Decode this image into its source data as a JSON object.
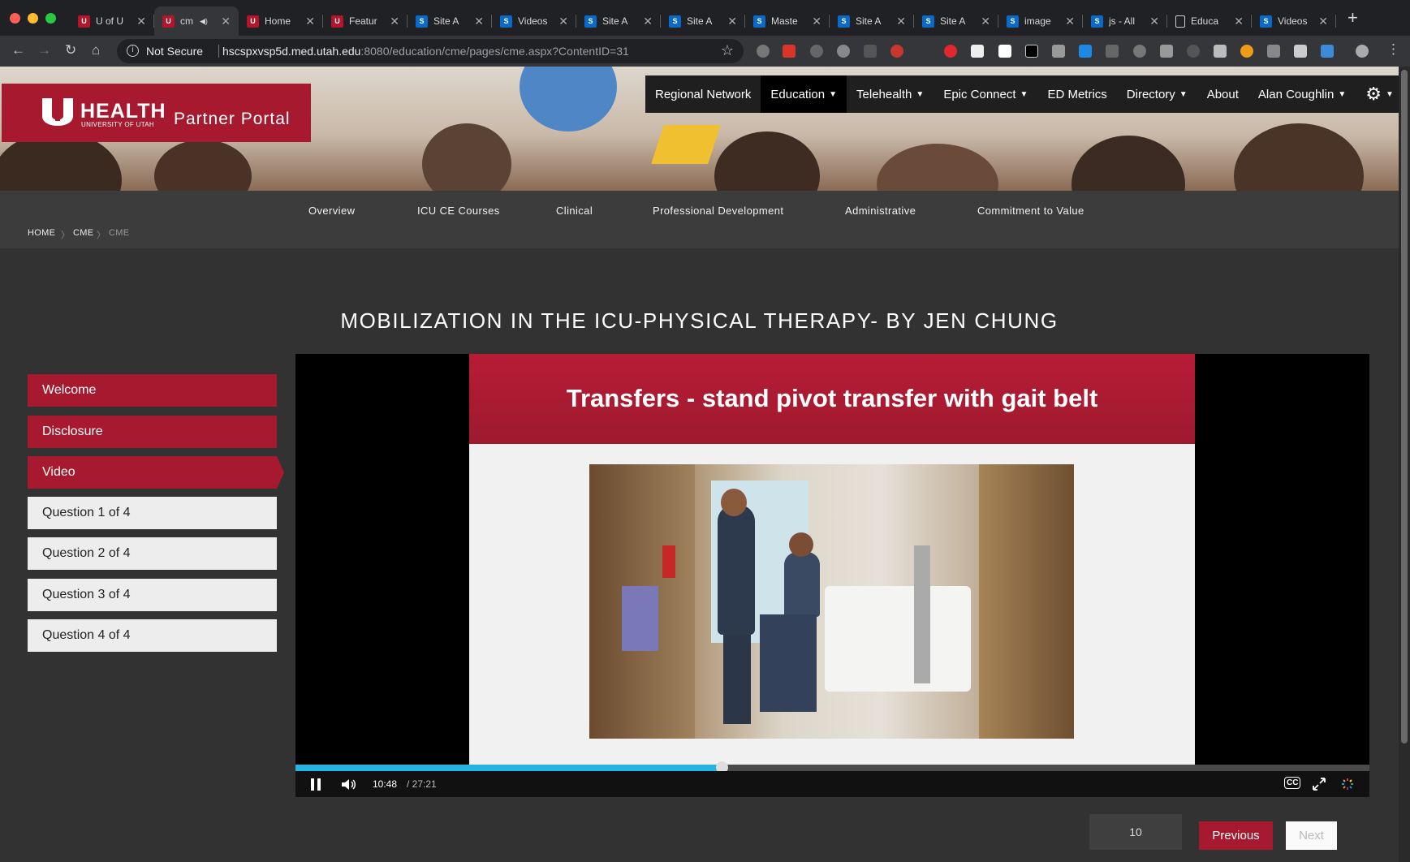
{
  "browser": {
    "tabs": [
      {
        "title": "U of U",
        "favicon": "utah-u-icon"
      },
      {
        "title": "cm",
        "favicon": "utah-u-icon",
        "active": true,
        "audio": true
      },
      {
        "title": "Home",
        "favicon": "utah-u-icon"
      },
      {
        "title": "Featur",
        "favicon": "utah-u-icon"
      },
      {
        "title": "Site A",
        "favicon": "sharepoint-icon"
      },
      {
        "title": "Videos",
        "favicon": "sharepoint-icon"
      },
      {
        "title": "Site A",
        "favicon": "sharepoint-icon"
      },
      {
        "title": "Site A",
        "favicon": "sharepoint-icon"
      },
      {
        "title": "Maste",
        "favicon": "sharepoint-icon"
      },
      {
        "title": "Site A",
        "favicon": "sharepoint-icon"
      },
      {
        "title": "Site A",
        "favicon": "sharepoint-icon"
      },
      {
        "title": "image",
        "favicon": "sharepoint-icon"
      },
      {
        "title": "js - All",
        "favicon": "sharepoint-icon"
      },
      {
        "title": "Educa",
        "favicon": "document-icon"
      },
      {
        "title": "Videos",
        "favicon": "sharepoint-icon"
      }
    ],
    "security_label": "Not Secure",
    "url_host": "hscspxvsp5d.med.utah.edu",
    "url_rest": ":8080/education/cme/pages/cme.aspx?ContentID=31"
  },
  "site": {
    "logo_health": "HEALTH",
    "logo_university": "UNIVERSITY OF UTAH",
    "logo_portal": "Partner Portal",
    "brand_color": "#a6192e",
    "top_nav": [
      {
        "label": "Regional Network",
        "dropdown": false
      },
      {
        "label": "Education",
        "dropdown": true,
        "active": true
      },
      {
        "label": "Telehealth",
        "dropdown": true
      },
      {
        "label": "Epic Connect",
        "dropdown": true
      },
      {
        "label": "ED Metrics",
        "dropdown": false
      },
      {
        "label": "Directory",
        "dropdown": true
      },
      {
        "label": "About",
        "dropdown": false
      },
      {
        "label": "Alan Coughlin",
        "dropdown": true
      }
    ],
    "sub_nav": [
      "Overview",
      "ICU CE Courses",
      "Clinical",
      "Professional Development",
      "Administrative",
      "Commitment to Value"
    ],
    "breadcrumb": [
      "HOME",
      "CME",
      "CME"
    ]
  },
  "course": {
    "title": "MOBILIZATION IN THE ICU-PHYSICAL THERAPY- BY JEN CHUNG",
    "steps": [
      {
        "label": "Welcome",
        "state": "done"
      },
      {
        "label": "Disclosure",
        "state": "done"
      },
      {
        "label": "Video",
        "state": "current"
      },
      {
        "label": "Question 1 of 4",
        "state": "todo"
      },
      {
        "label": "Question 2 of 4",
        "state": "todo"
      },
      {
        "label": "Question 3 of 4",
        "state": "todo"
      },
      {
        "label": "Question 4 of 4",
        "state": "todo"
      }
    ]
  },
  "video": {
    "slide_title": "Transfers - stand pivot transfer with gait belt",
    "current_time": "10:48",
    "duration": "/ 27:21",
    "progress_fraction": 0.397,
    "accent_color": "#26b3e0"
  },
  "pager": {
    "page_value": "10",
    "previous_label": "Previous",
    "next_label": "Next"
  }
}
